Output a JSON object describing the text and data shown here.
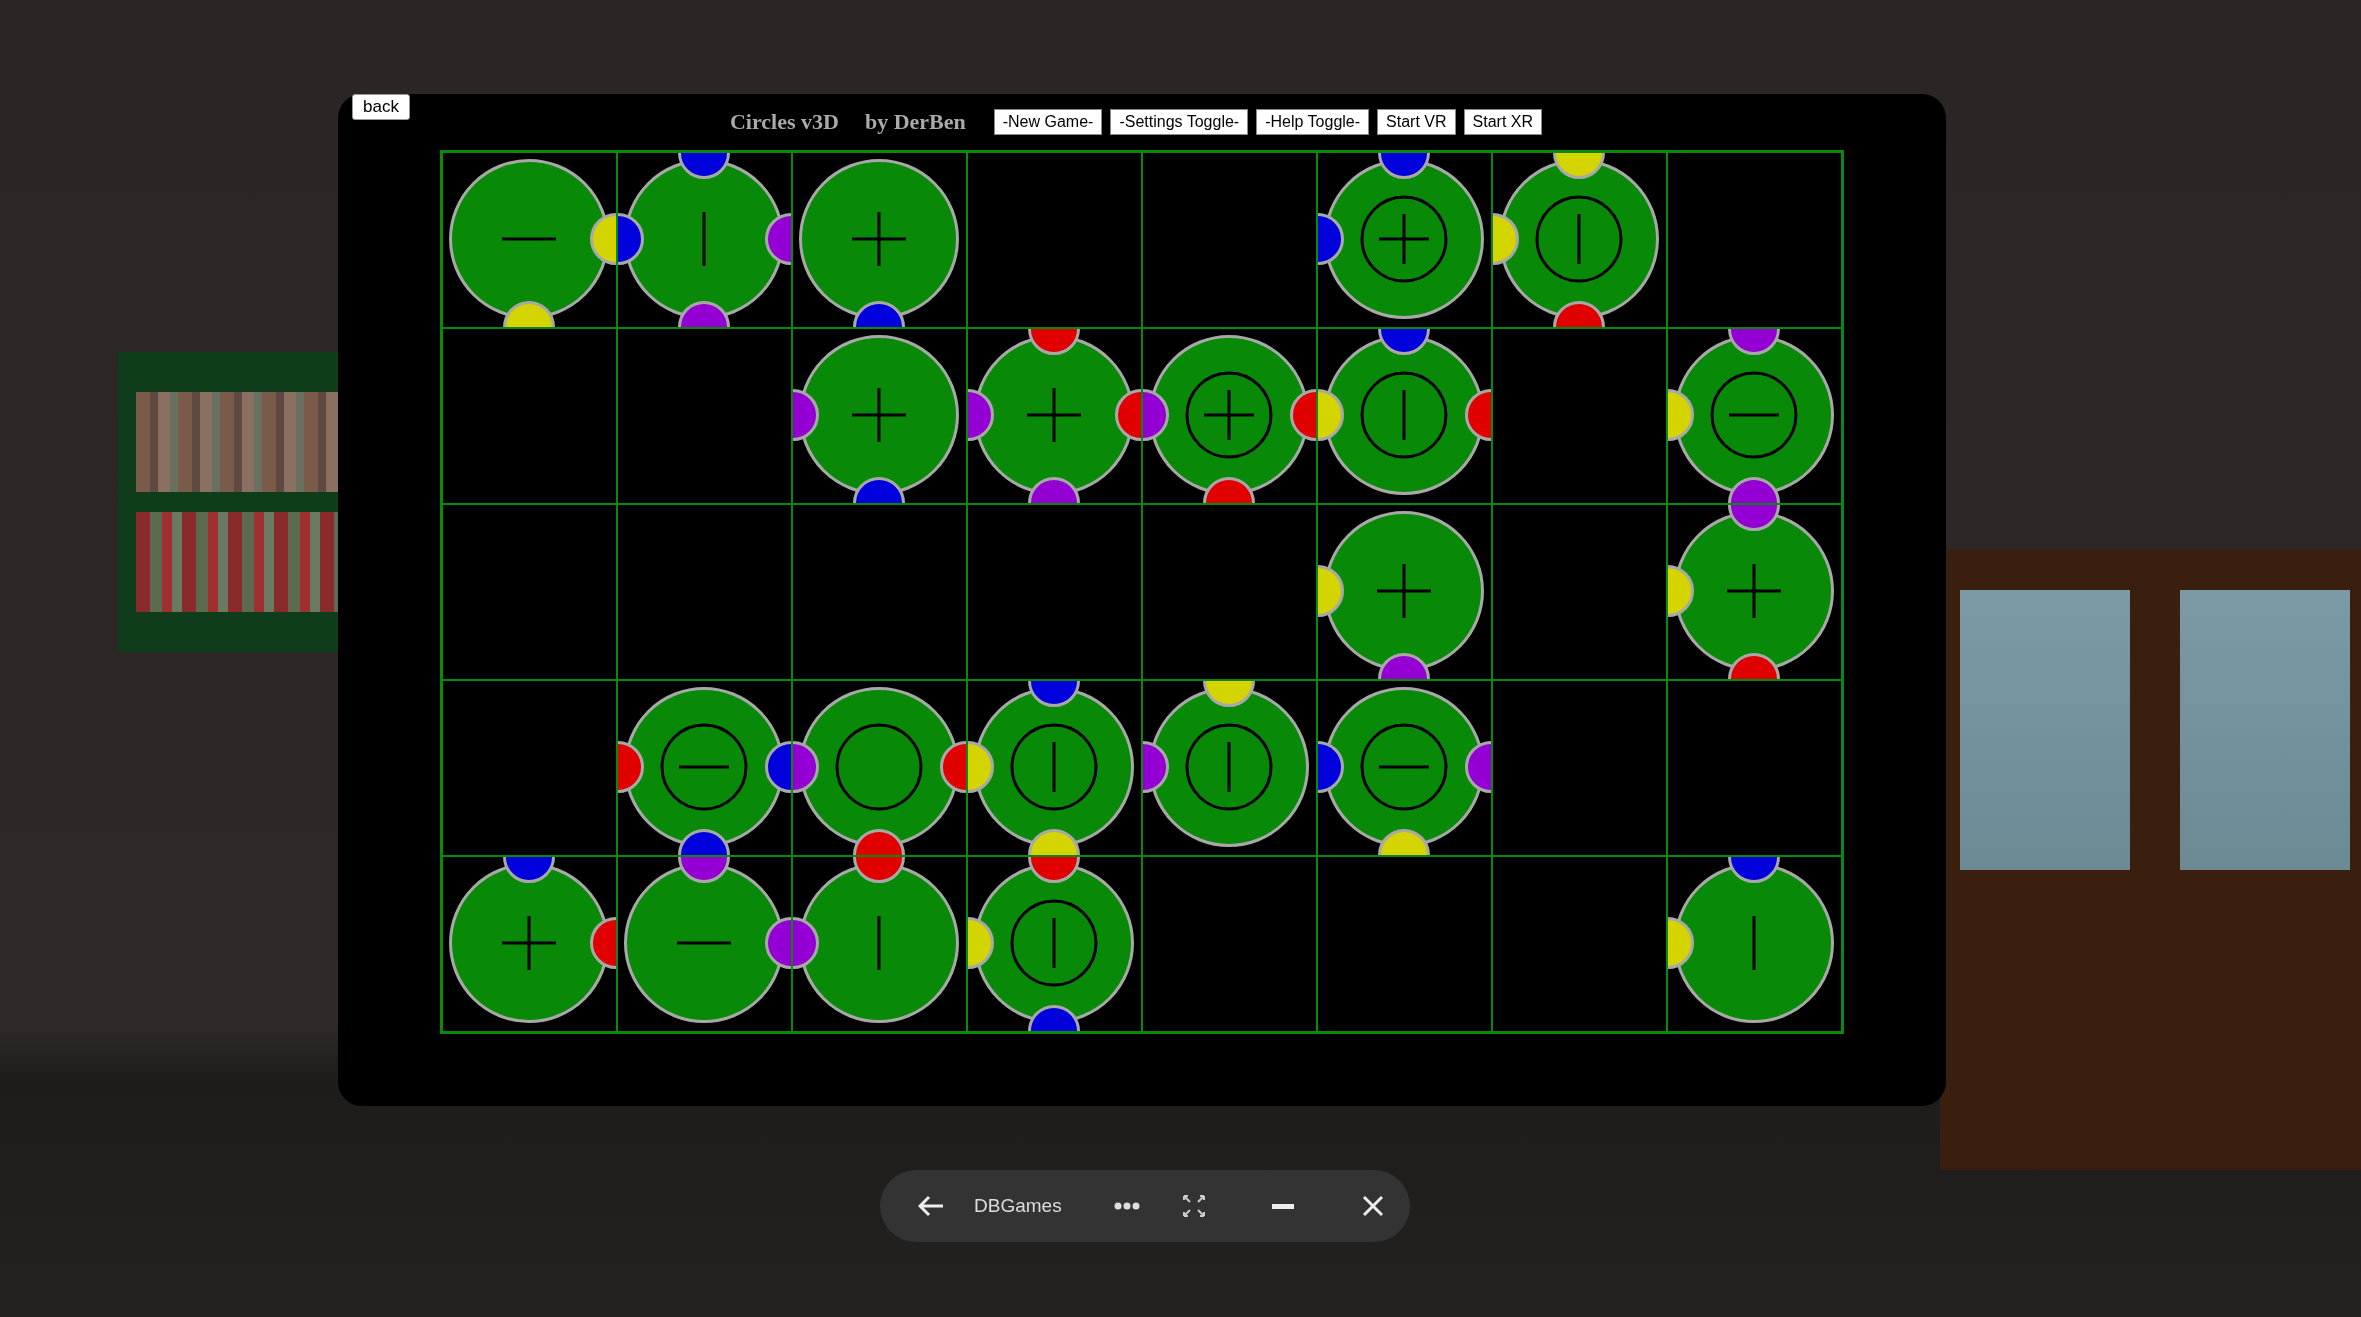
{
  "browser_page": {
    "back_button": "back",
    "title": "Circles v3D",
    "author": "by DerBen",
    "buttons": [
      "-New Game-",
      "-Settings Toggle-",
      "-Help Toggle-",
      "Start VR",
      "Start XR"
    ]
  },
  "board": [
    [
      {
        "kind": "minus",
        "ring": false,
        "knobs": {
          "right": {
            "color": "#d4d400"
          },
          "bottom": {
            "color": "#d4d400"
          }
        }
      },
      {
        "kind": "bar",
        "ring": false,
        "knobs": {
          "top": {
            "color": "#0000dd"
          },
          "left": {
            "color": "#0000dd"
          },
          "right": {
            "color": "#9400d3"
          },
          "bottom": {
            "color": "#9400d3"
          }
        }
      },
      {
        "kind": "plus",
        "ring": false,
        "knobs": {
          "bottom": {
            "color": "#0000dd"
          }
        }
      },
      {
        "kind": "empty"
      },
      {
        "kind": "empty"
      },
      {
        "kind": "plus",
        "ring": true,
        "knobs": {
          "top": {
            "color": "#0000dd"
          },
          "left": {
            "color": "#0000dd"
          }
        }
      },
      {
        "kind": "bar",
        "ring": true,
        "knobs": {
          "top": {
            "color": "#d4d400"
          },
          "left": {
            "color": "#d4d400"
          },
          "bottom": {
            "color": "#e00000"
          }
        }
      },
      {
        "kind": "empty"
      }
    ],
    [
      {
        "kind": "empty"
      },
      {
        "kind": "empty"
      },
      {
        "kind": "plus",
        "ring": false,
        "knobs": {
          "left": {
            "color": "#9400d3"
          },
          "bottom": {
            "color": "#0000dd"
          }
        }
      },
      {
        "kind": "plus",
        "ring": false,
        "knobs": {
          "top": {
            "color": "#e00000"
          },
          "left": {
            "color": "#9400d3"
          },
          "right": {
            "color": "#e00000"
          },
          "bottom": {
            "color": "#9400d3"
          }
        }
      },
      {
        "kind": "plus",
        "ring": true,
        "knobs": {
          "left": {
            "color": "#9400d3"
          },
          "right": {
            "color": "#e00000"
          },
          "bottom": {
            "color": "#e00000"
          }
        }
      },
      {
        "kind": "bar",
        "ring": true,
        "knobs": {
          "top": {
            "color": "#0000dd"
          },
          "left": {
            "color": "#d4d400"
          },
          "right": {
            "color": "#e00000"
          }
        }
      },
      {
        "kind": "empty"
      },
      {
        "kind": "minus",
        "ring": true,
        "knobs": {
          "top": {
            "color": "#9400d3"
          },
          "left": {
            "color": "#d4d400"
          },
          "bottom": {
            "color": "#9400d3"
          }
        }
      }
    ],
    [
      {
        "kind": "empty"
      },
      {
        "kind": "empty"
      },
      {
        "kind": "empty"
      },
      {
        "kind": "empty"
      },
      {
        "kind": "empty"
      },
      {
        "kind": "plus",
        "ring": false,
        "knobs": {
          "left": {
            "color": "#d4d400"
          },
          "bottom": {
            "color": "#9400d3"
          }
        }
      },
      {
        "kind": "empty"
      },
      {
        "kind": "plus",
        "ring": false,
        "knobs": {
          "top": {
            "color": "#9400d3"
          },
          "left": {
            "color": "#d4d400"
          },
          "bottom": {
            "color": "#e00000"
          }
        }
      }
    ],
    [
      {
        "kind": "empty"
      },
      {
        "kind": "minus",
        "ring": true,
        "knobs": {
          "left": {
            "color": "#e00000"
          },
          "right": {
            "color": "#0000dd"
          },
          "bottom": {
            "color": "#0000dd"
          }
        }
      },
      {
        "kind": "blank",
        "ring": true,
        "knobs": {
          "left": {
            "color": "#9400d3"
          },
          "right": {
            "color": "#e00000"
          },
          "bottom": {
            "color": "#e00000"
          }
        }
      },
      {
        "kind": "bar",
        "ring": true,
        "knobs": {
          "top": {
            "color": "#0000dd"
          },
          "left": {
            "color": "#d4d400"
          },
          "bottom": {
            "color": "#d4d400"
          }
        }
      },
      {
        "kind": "bar",
        "ring": true,
        "knobs": {
          "top": {
            "color": "#d4d400"
          },
          "left": {
            "color": "#9400d3"
          }
        }
      },
      {
        "kind": "minus",
        "ring": true,
        "knobs": {
          "left": {
            "color": "#0000dd"
          },
          "right": {
            "color": "#9400d3"
          },
          "bottom": {
            "color": "#d4d400"
          }
        }
      },
      {
        "kind": "empty"
      },
      {
        "kind": "empty"
      }
    ],
    [
      {
        "kind": "plus",
        "ring": false,
        "knobs": {
          "top": {
            "color": "#0000dd"
          },
          "right": {
            "color": "#e00000"
          }
        }
      },
      {
        "kind": "minus",
        "ring": false,
        "knobs": {
          "top": {
            "color": "#9400d3"
          },
          "right": {
            "color": "#9400d3"
          }
        }
      },
      {
        "kind": "bar",
        "ring": false,
        "knobs": {
          "top": {
            "color": "#e00000"
          },
          "left": {
            "color": "#9400d3"
          }
        }
      },
      {
        "kind": "bar",
        "ring": true,
        "knobs": {
          "top": {
            "color": "#e00000"
          },
          "left": {
            "color": "#d4d400"
          },
          "bottom": {
            "color": "#0000dd"
          }
        }
      },
      {
        "kind": "empty"
      },
      {
        "kind": "empty"
      },
      {
        "kind": "empty"
      },
      {
        "kind": "bar",
        "ring": false,
        "knobs": {
          "top": {
            "color": "#0000dd"
          },
          "left": {
            "color": "#d4d400"
          }
        }
      }
    ]
  ],
  "window_bar": {
    "app_name": "DBGames"
  }
}
